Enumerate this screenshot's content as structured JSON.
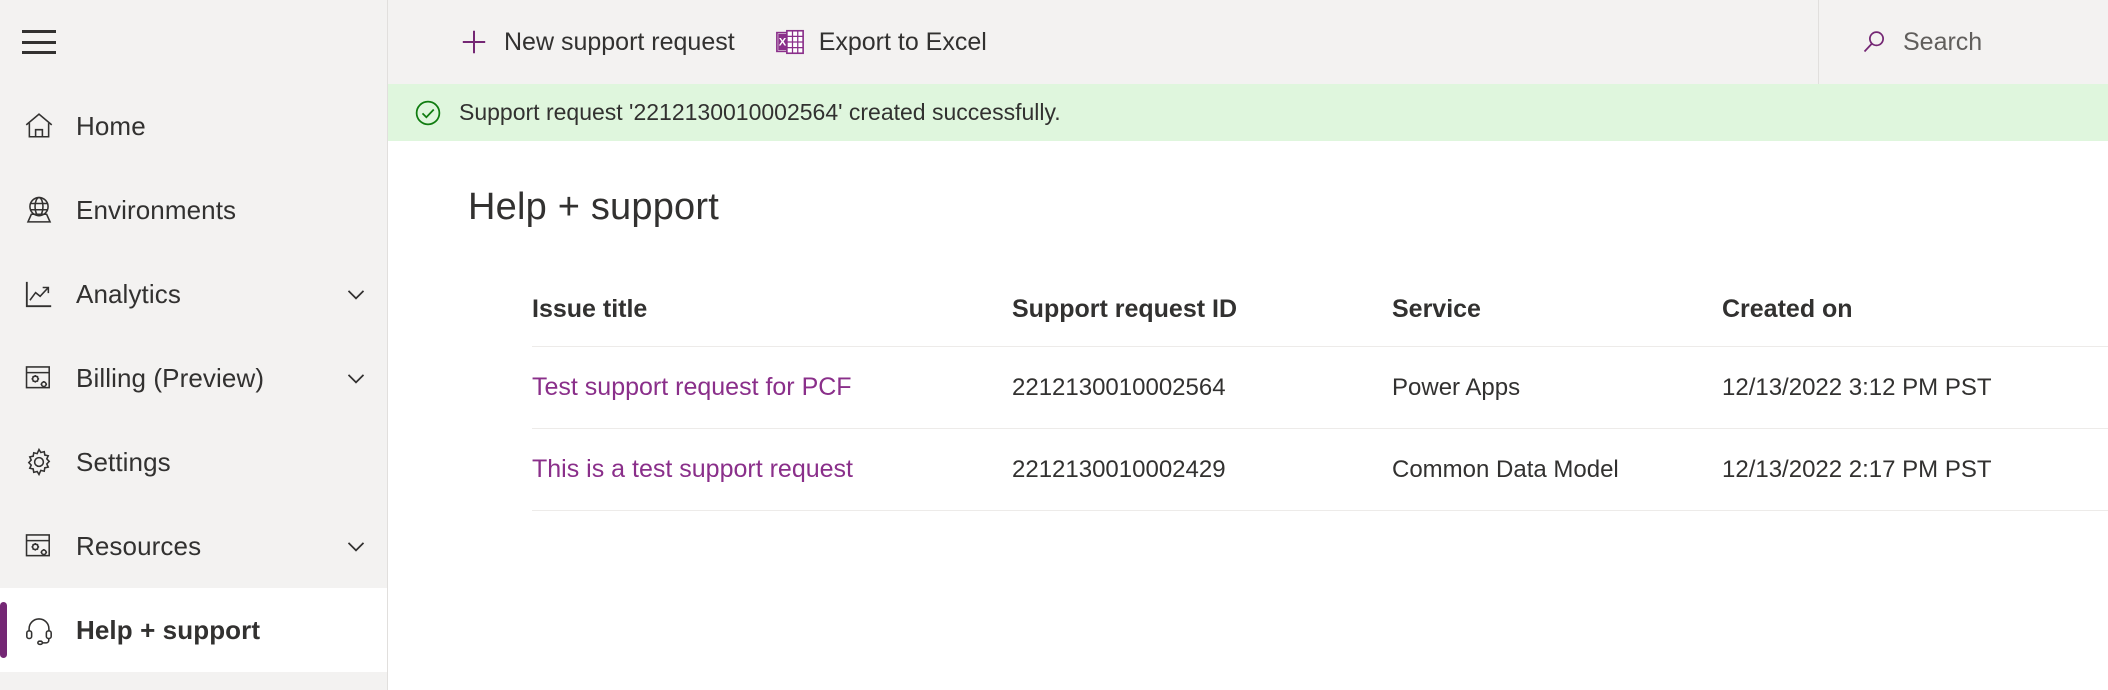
{
  "sidebar": {
    "menu_button_icon": "hamburger-icon",
    "items": [
      {
        "label": "Home",
        "icon": "home-icon",
        "chevron": false,
        "selected": false
      },
      {
        "label": "Environments",
        "icon": "globe-icon",
        "chevron": false,
        "selected": false
      },
      {
        "label": "Analytics",
        "icon": "line-chart-icon",
        "chevron": true,
        "selected": false
      },
      {
        "label": "Billing (Preview)",
        "icon": "billing-icon",
        "chevron": true,
        "selected": false
      },
      {
        "label": "Settings",
        "icon": "gear-icon",
        "chevron": false,
        "selected": false
      },
      {
        "label": "Resources",
        "icon": "resources-icon",
        "chevron": true,
        "selected": false
      },
      {
        "label": "Help + support",
        "icon": "headset-icon",
        "chevron": false,
        "selected": true
      }
    ]
  },
  "command_bar": {
    "new_request_label": "New support request",
    "new_request_icon": "plus-icon",
    "export_label": "Export to Excel",
    "export_icon": "excel-icon"
  },
  "search": {
    "placeholder": "Search",
    "icon": "search-icon"
  },
  "banner": {
    "icon": "success-check-circle-icon",
    "message": "Support request '2212130010002564' created successfully.",
    "background": "#dff6dd",
    "icon_color": "#107c10"
  },
  "page": {
    "title": "Help + support"
  },
  "table": {
    "columns": [
      "Issue title",
      "Support request ID",
      "Service",
      "Created on"
    ],
    "rows": [
      {
        "issue_title": "Test support request for PCF",
        "support_request_id": "2212130010002564",
        "service": "Power Apps",
        "created_on": "12/13/2022 3:12 PM PST"
      },
      {
        "issue_title": "This is a test support request",
        "support_request_id": "2212130010002429",
        "service": "Common Data Model",
        "created_on": "12/13/2022 2:17 PM PST"
      }
    ]
  },
  "colors": {
    "accent_purple": "#742774",
    "link_purple": "#8a2f8a",
    "sidebar_bg": "#f3f2f1",
    "success_green": "#107c10",
    "text": "#323130"
  }
}
